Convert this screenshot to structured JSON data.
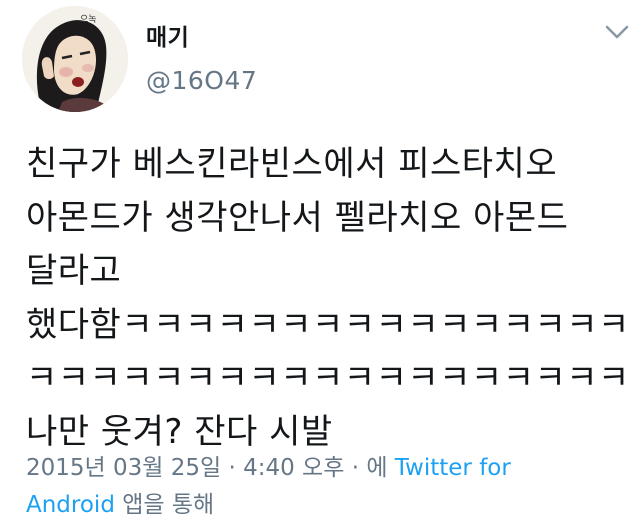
{
  "user": {
    "display_name": "매기",
    "handle": "@16O47",
    "avatar_icon": "avatar-drawing"
  },
  "menu": {
    "icon": "chevron-down-icon"
  },
  "tweet": {
    "lines": [
      "친구가 베스킨라빈스에서 피스타치오",
      "아몬드가 생각안나서 펠라치오 아몬드",
      "달라고",
      "했다함ㅋㅋㅋㅋㅋㅋㅋㅋㅋㅋㅋㅋㅋㅋㅋㅋ",
      "ㅋㅋㅋㅋㅋㅋㅋㅋㅋㅋㅋㅋㅋㅋㅋㅋㅋㅋㅋ",
      "나만 웃겨? 잔다 시발"
    ]
  },
  "meta": {
    "timestamp": "2015년 03월 25일 · 4:40 오후 · 에 ",
    "source_line1": "Twitter for",
    "source_line2": "Android",
    "suffix": " 앱을 통해"
  },
  "colors": {
    "text": "#14171a",
    "secondary": "#657786",
    "link": "#1da1f2"
  }
}
